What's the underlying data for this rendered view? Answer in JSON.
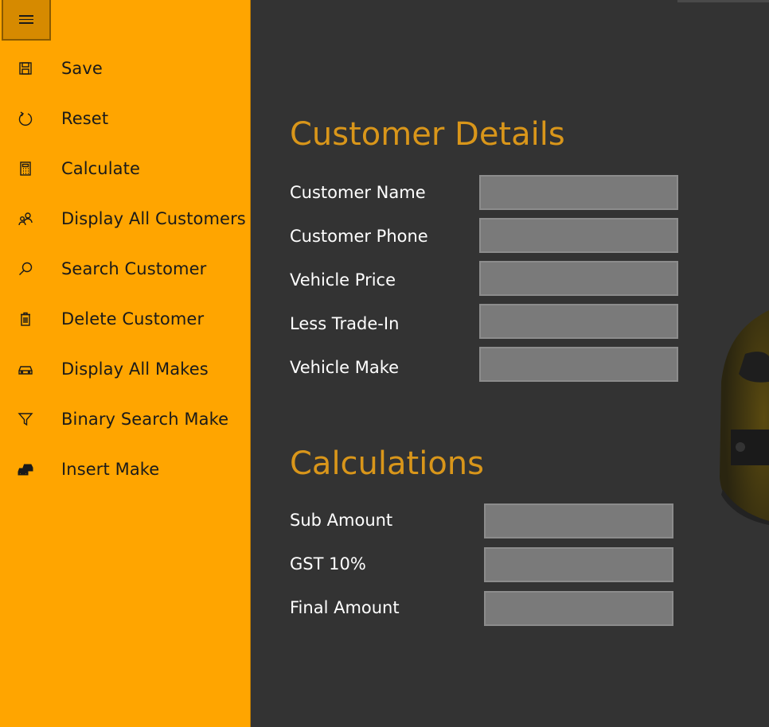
{
  "menu": {
    "toggle_icon": "hamburger-icon",
    "items": [
      {
        "label": "Save",
        "icon": "save-icon"
      },
      {
        "label": "Reset",
        "icon": "refresh-icon"
      },
      {
        "label": "Calculate",
        "icon": "calculator-icon"
      },
      {
        "label": "Display All Customers",
        "icon": "people-icon"
      },
      {
        "label": "Search Customer",
        "icon": "search-icon"
      },
      {
        "label": "Delete Customer",
        "icon": "trash-icon"
      },
      {
        "label": "Display All Makes",
        "icon": "car-icon"
      },
      {
        "label": "Binary Search Make",
        "icon": "filter-icon"
      },
      {
        "label": "Insert Make",
        "icon": "cars-icon"
      }
    ]
  },
  "customer_details": {
    "title": "Customer Details",
    "fields": [
      {
        "label": "Customer Name",
        "value": ""
      },
      {
        "label": "Customer Phone",
        "value": ""
      },
      {
        "label": "Vehicle Price",
        "value": ""
      },
      {
        "label": "Less Trade-In",
        "value": ""
      },
      {
        "label": "Vehicle Make",
        "value": ""
      }
    ]
  },
  "calculations": {
    "title": "Calculations",
    "fields": [
      {
        "label": "Sub Amount",
        "value": ""
      },
      {
        "label": "GST 10%",
        "value": ""
      },
      {
        "label": "Final Amount",
        "value": ""
      }
    ]
  },
  "colors": {
    "sidebar": "#ffa500",
    "accent_title": "#d9961a",
    "background": "#333333",
    "field": "#7a7a7a"
  }
}
